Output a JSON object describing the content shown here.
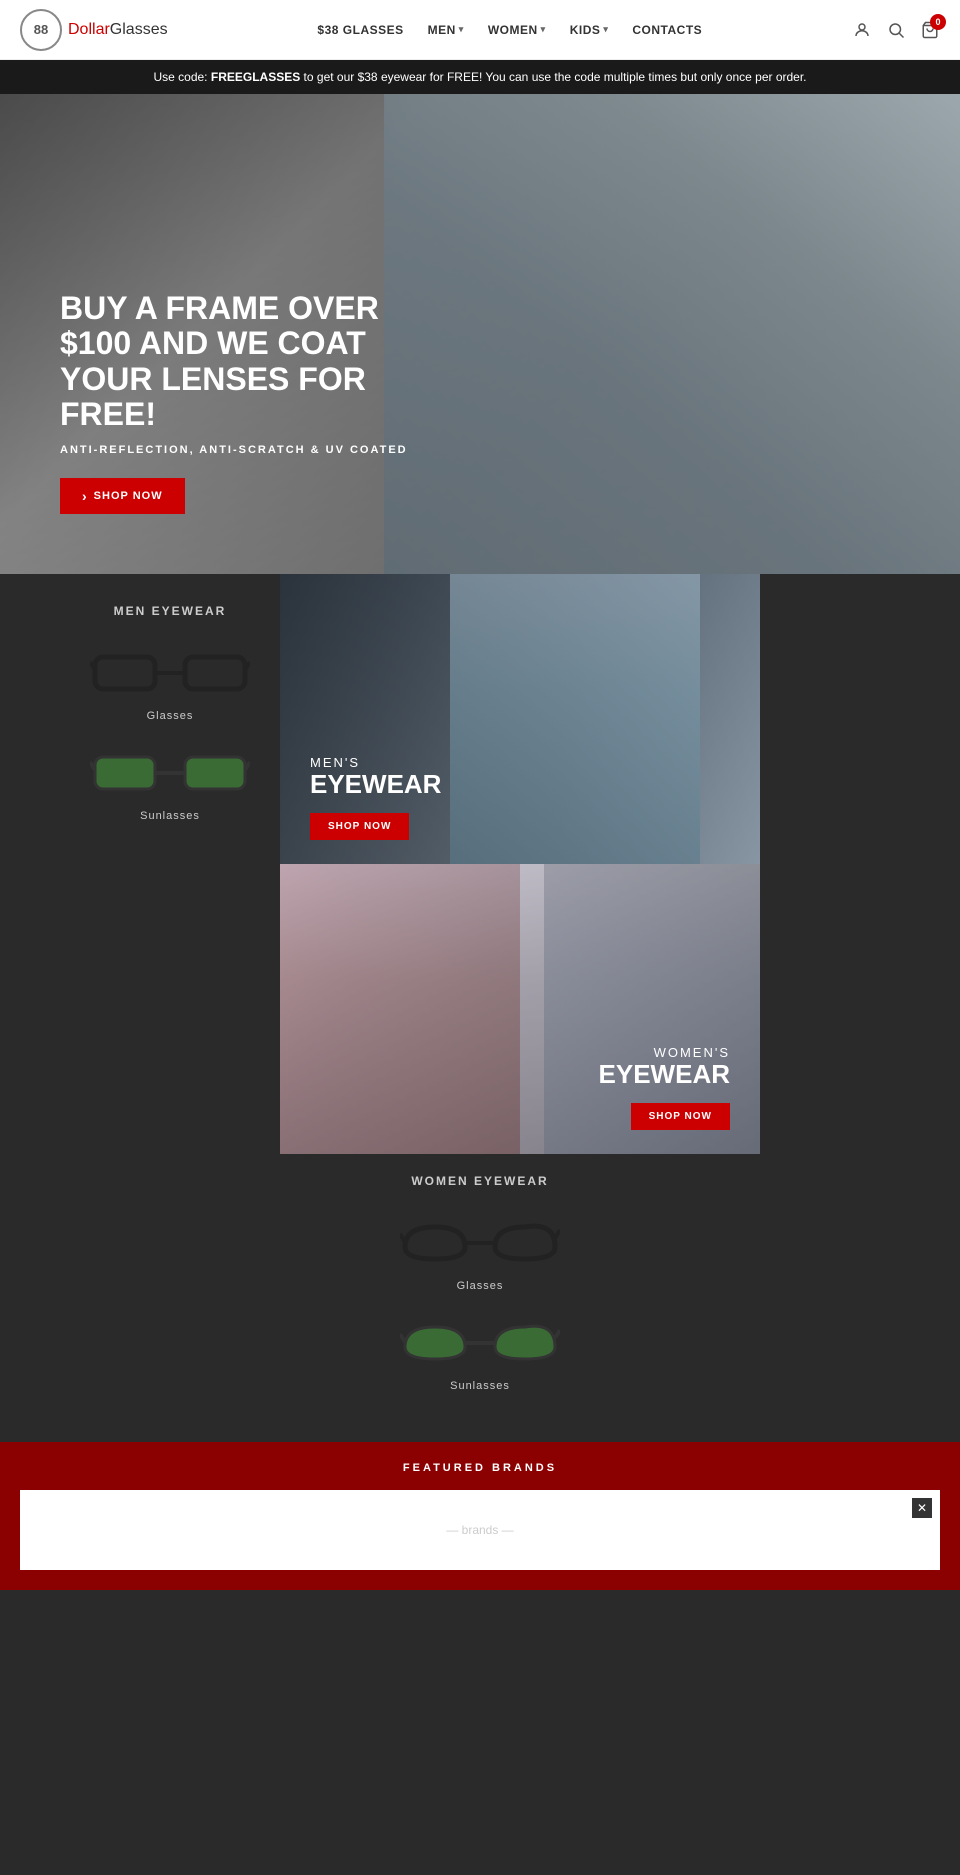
{
  "header": {
    "logo_number": "88",
    "logo_brand": "DollarGlasses",
    "nav": [
      {
        "id": "38glasses",
        "label": "$38 GLASSES",
        "hasDropdown": false
      },
      {
        "id": "men",
        "label": "MEN",
        "hasDropdown": true
      },
      {
        "id": "women",
        "label": "WOMEN",
        "hasDropdown": true
      },
      {
        "id": "kids",
        "label": "KIDS",
        "hasDropdown": true
      },
      {
        "id": "contacts",
        "label": "CONTACTS",
        "hasDropdown": false
      }
    ],
    "cart_count": "0"
  },
  "promo": {
    "text_before": "Use code: ",
    "code": "FREEGLASSES",
    "text_after": " to get our $38 eyewear for FREE! You can use the code multiple times but only once per order."
  },
  "hero": {
    "title": "BUY A FRAME OVER $100 AND WE COAT YOUR LENSES FOR FREE!",
    "subtitle": "ANTI-REFLECTION, ANTI-SCRATCH & UV COATED",
    "button_label": "SHOP NOW"
  },
  "men_eyewear": {
    "section_title": "MEN EYEWEAR",
    "items": [
      {
        "label": "Glasses"
      },
      {
        "label": "Sunlasses"
      }
    ]
  },
  "men_banner": {
    "subtitle": "MEN'S",
    "title": "EYEWEAR",
    "button_label": "SHOP NOW"
  },
  "women_banner": {
    "subtitle": "WOMEN'S",
    "title": "EYEWEAR",
    "button_label": "SHOP NOW"
  },
  "women_eyewear": {
    "section_title": "WOMEN EYEWEAR",
    "items": [
      {
        "label": "Glasses"
      },
      {
        "label": "Sunlasses"
      }
    ]
  },
  "featured_brands": {
    "title": "FEATURED BRANDS"
  },
  "colors": {
    "red": "#cc0000",
    "dark_bg": "#2a2a2a",
    "dark_red": "#8b0000"
  }
}
